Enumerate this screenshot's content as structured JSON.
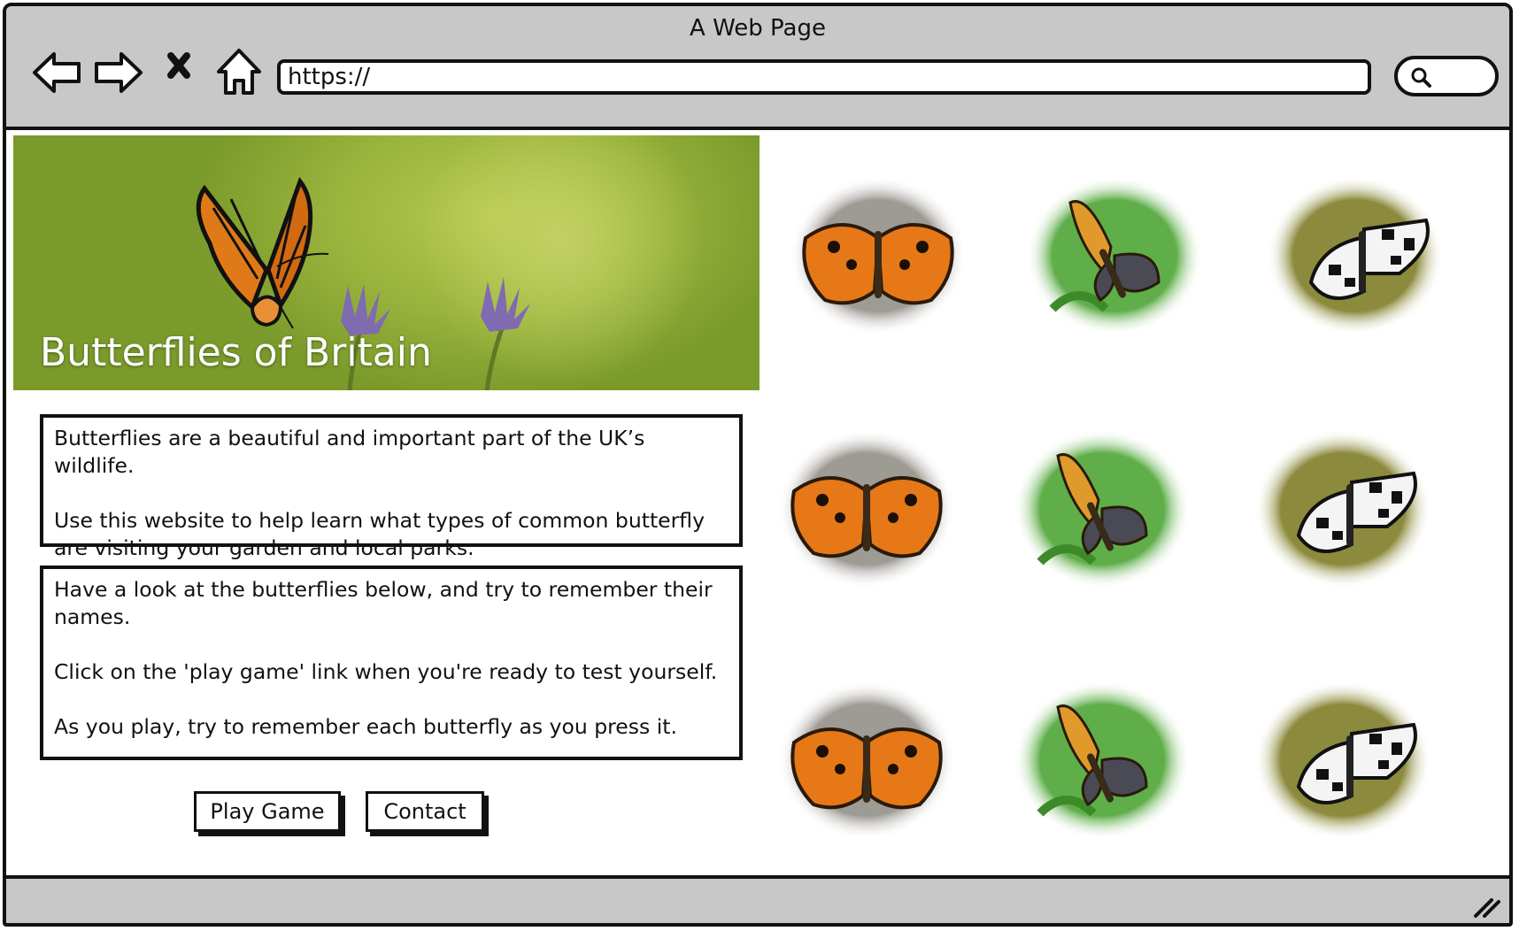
{
  "window": {
    "title": "A Web Page"
  },
  "toolbar": {
    "url": "https://"
  },
  "hero": {
    "title": "Butterflies of Britain"
  },
  "intro": {
    "line1": "Butterflies are a beautiful and important part of the UK’s wildlife.",
    "line2": "Use this website to help learn what types of common butterfly are visiting your garden and local parks."
  },
  "instructions": {
    "line1": "Have a look at the butterflies below, and try to remember their names.",
    "line2": "Click on the 'play game' link when you're ready to test yourself.",
    "line3": "As you play, try to remember each butterfly as you press it."
  },
  "buttons": {
    "play": "Play Game",
    "contact": "Contact"
  },
  "colors": {
    "chrome": "#c8c8c8",
    "outline": "#111111",
    "hero_green": "#98b23b"
  }
}
